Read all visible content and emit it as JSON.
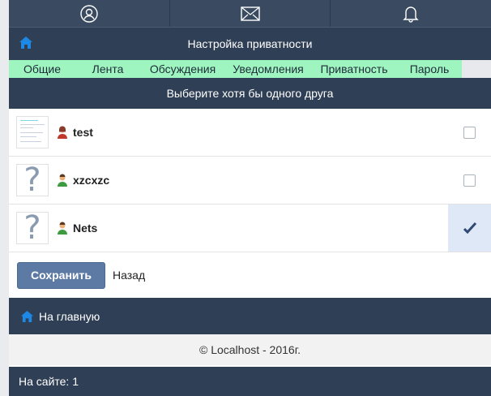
{
  "top_nav": {
    "items": [
      {
        "icon": "user-icon"
      },
      {
        "icon": "mail-icon"
      },
      {
        "icon": "bell-icon"
      }
    ]
  },
  "header": {
    "home_icon": "home-icon",
    "title": "Настройка приватности"
  },
  "tabs": [
    "Общие",
    "Лента",
    "Обсуждения",
    "Уведомления",
    "Приватность",
    "Пароль"
  ],
  "prompt": "Выберите хотя бы одного друга",
  "friends": [
    {
      "name": "test",
      "avatar": "thumbnail-image",
      "user_icon": "user-female-icon",
      "checked": false
    },
    {
      "name": "xzcxzc",
      "avatar": "question-mark-icon",
      "user_icon": "user-male-icon",
      "checked": false
    },
    {
      "name": "Nets",
      "avatar": "question-mark-icon",
      "user_icon": "user-male-icon",
      "checked": true
    }
  ],
  "avatar_placeholder": "?",
  "actions": {
    "save_label": "Сохранить",
    "back_label": "Назад"
  },
  "home_link": {
    "icon": "home-icon",
    "label": "На главную"
  },
  "footer": "© Localhost - 2016г.",
  "online": "На сайте: 1",
  "colors": {
    "header": "#2f3f55",
    "tab_bar": "#9ff5bf",
    "button": "#5c7aa3",
    "accent": "#1e88e5"
  }
}
